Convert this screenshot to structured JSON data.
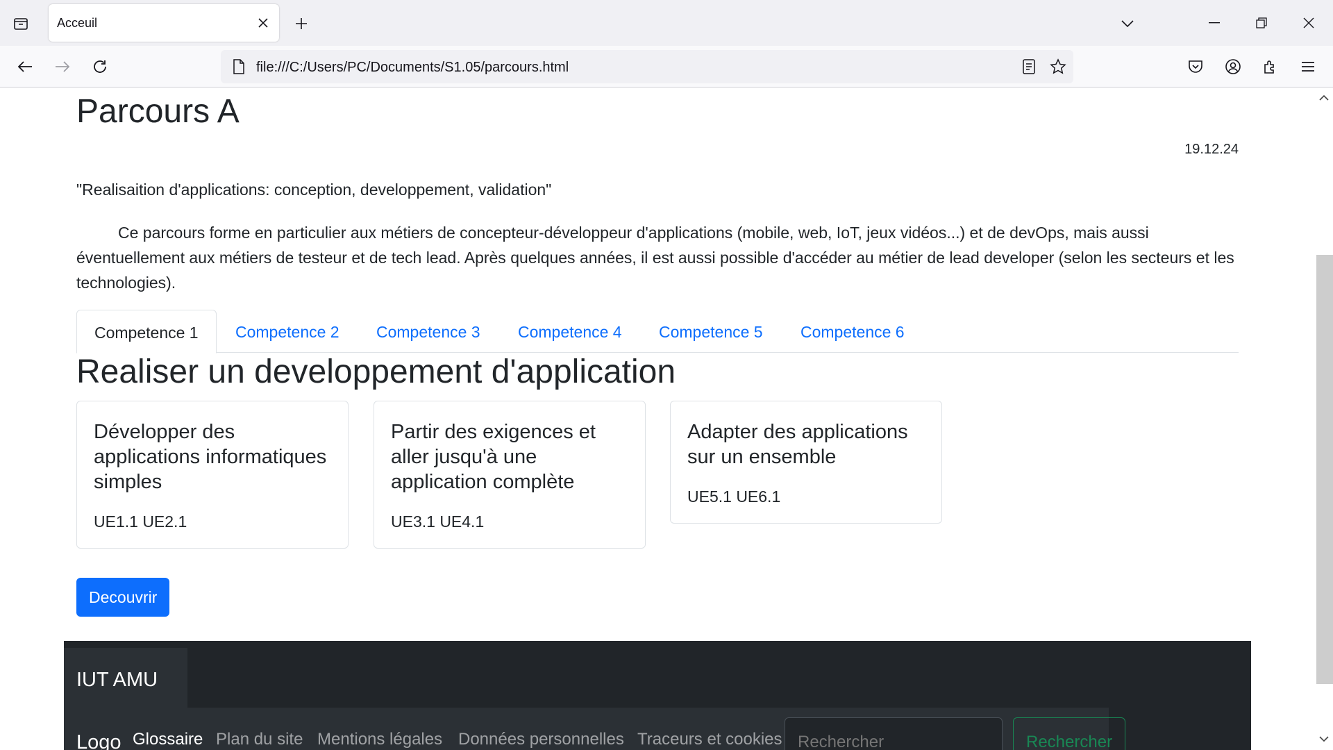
{
  "browser": {
    "tab_title": "Acceuil",
    "url": "file:///C:/Users/PC/Documents/S1.05/parcours.html"
  },
  "page": {
    "title": "Parcours A",
    "date": "19.12.24",
    "subtitle": "\"Realisaition d'applications: conception, developpement, validation\"",
    "description": "Ce parcours forme en particulier aux métiers de concepteur-développeur d'applications (mobile, web, IoT, jeux vidéos...) et de devOps, mais aussi éventuellement aux métiers de testeur et de tech lead. Après quelques années, il est aussi possible d'accéder au métier de lead developer (selon les secteurs et les technologies).",
    "tabs": [
      {
        "label": "Competence 1",
        "active": true
      },
      {
        "label": "Competence 2"
      },
      {
        "label": "Competence 3"
      },
      {
        "label": "Competence 4"
      },
      {
        "label": "Competence 5"
      },
      {
        "label": "Competence 6"
      }
    ],
    "section_title": "Realiser un developpement d'application",
    "cards": [
      {
        "title": "Développer des applications informatiques simples",
        "text": "UE1.1 UE2.1"
      },
      {
        "title": "Partir des exigences et aller jusqu'à une application complète",
        "text": "UE3.1 UE4.1"
      },
      {
        "title": "Adapter des applications sur un ensemble",
        "text": "UE5.1 UE6.1"
      }
    ],
    "button_label": "Decouvrir"
  },
  "footer": {
    "brand": "IUT AMU",
    "logo": "Logo",
    "links": [
      "Glossaire",
      "Plan du site",
      "Mentions légales",
      "Données personnelles",
      "Traceurs et cookies"
    ],
    "search_placeholder": "Rechercher",
    "search_button": "Rechercher"
  },
  "colors": {
    "link": "#0d6efd",
    "primary": "#0d6efd",
    "footer_bg": "#212529",
    "success": "#198754"
  },
  "icons": [
    "tab-list-icon",
    "close-icon",
    "plus-icon",
    "chevron-down-icon",
    "minimize-icon",
    "restore-icon",
    "back-icon",
    "forward-icon",
    "reload-icon",
    "page-icon",
    "reader-view-icon",
    "bookmark-star-icon",
    "pocket-icon",
    "account-icon",
    "extensions-icon",
    "menu-icon"
  ]
}
